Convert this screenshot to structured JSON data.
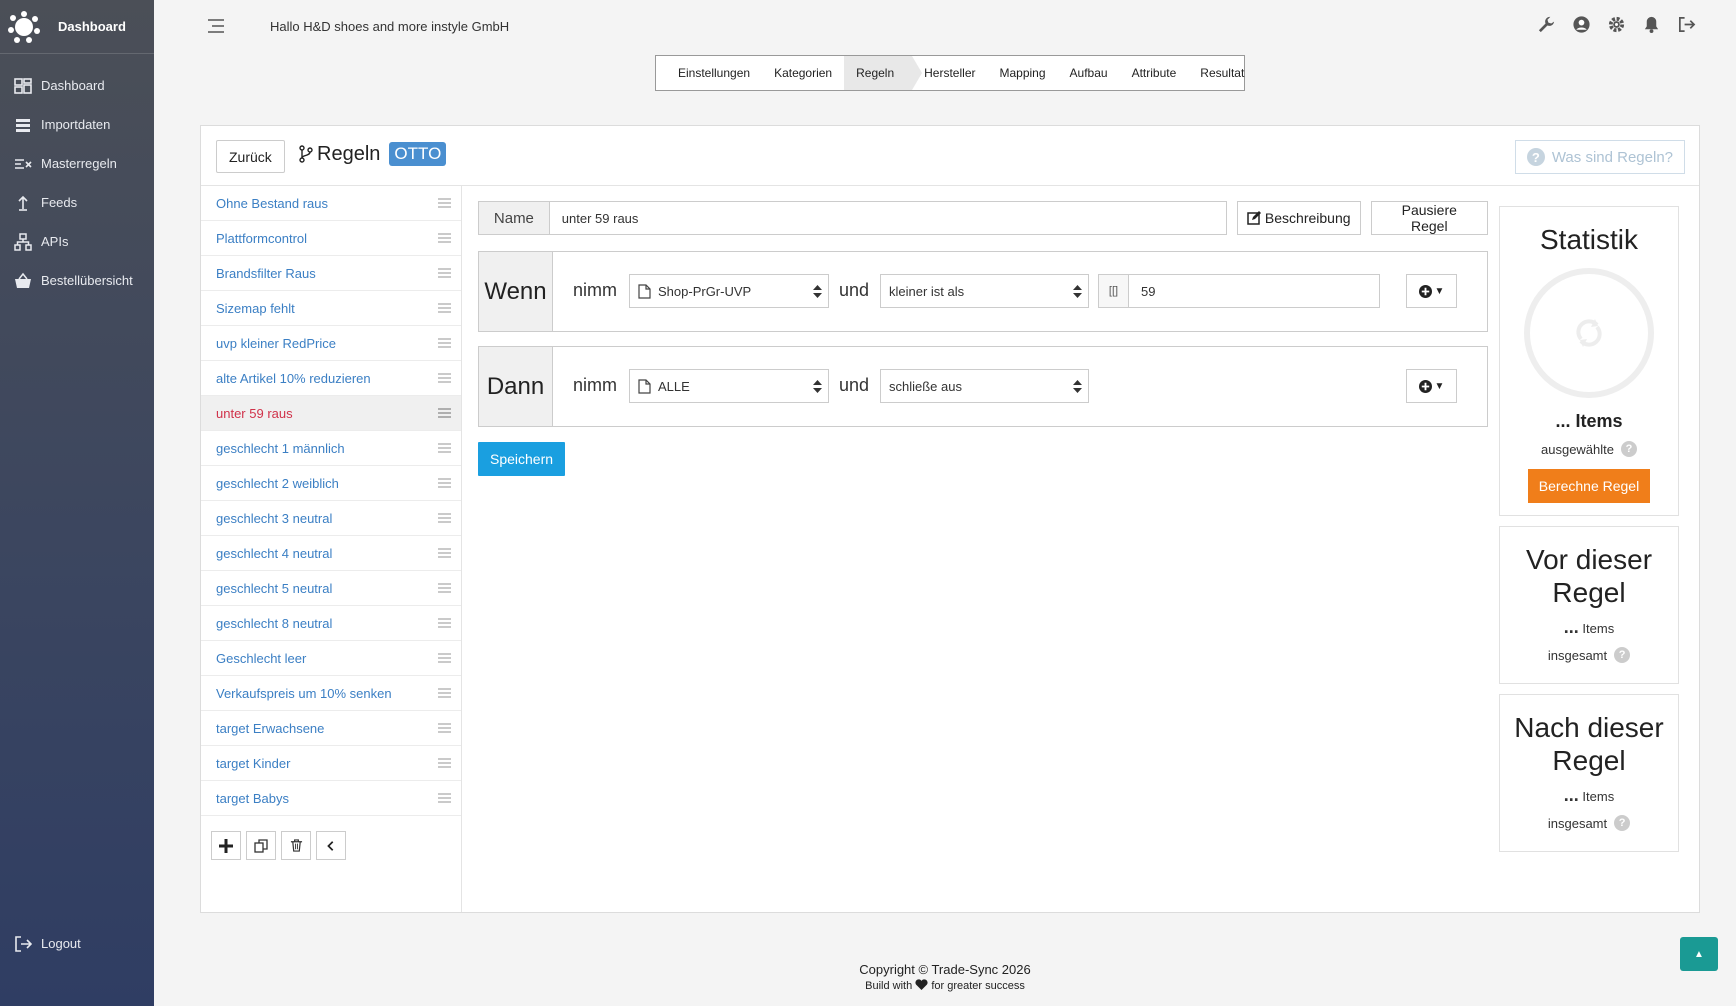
{
  "sidebar": {
    "brand": "Dashboard",
    "items": [
      {
        "label": "Dashboard",
        "icon": "dashboard-icon"
      },
      {
        "label": "Importdaten",
        "icon": "database-icon"
      },
      {
        "label": "Masterregeln",
        "icon": "rules-icon"
      },
      {
        "label": "Feeds",
        "icon": "upload-icon"
      },
      {
        "label": "APIs",
        "icon": "network-icon"
      },
      {
        "label": "Bestellübersicht",
        "icon": "basket-icon"
      }
    ],
    "logout": "Logout"
  },
  "topbar": {
    "greeting": "Hallo H&D shoes and more instyle GmbH",
    "icons": [
      "wrench-icon",
      "user-icon",
      "gear-icon",
      "bell-icon",
      "signout-icon"
    ]
  },
  "steps": [
    "Einstellungen",
    "Kategorien",
    "Regeln",
    "Hersteller",
    "Mapping",
    "Aufbau",
    "Attribute",
    "Resultat"
  ],
  "header": {
    "back": "Zurück",
    "title": "Regeln",
    "badge": "OTTO",
    "help": "Was sind Regeln?"
  },
  "rules": [
    "Ohne Bestand raus",
    "Plattformcontrol",
    "Brandsfilter Raus",
    "Sizemap fehlt",
    "uvp kleiner RedPrice",
    "alte Artikel 10% reduzieren",
    "unter 59 raus",
    "geschlecht 1 männlich",
    "geschlecht 2 weiblich",
    "geschlecht 3 neutral",
    "geschlecht 4 neutral",
    "geschlecht 5 neutral",
    "geschlecht 8 neutral",
    "Geschlecht leer",
    "Verkaufspreis um 10% senken",
    "target Erwachsene",
    "target Kinder",
    "target Babys"
  ],
  "editor": {
    "name_label": "Name",
    "name_value": "unter 59 raus",
    "desc_button": "Beschreibung",
    "pause_button": "Pausiere Regel",
    "wenn": {
      "label": "Wenn",
      "take": "nimm",
      "field": "Shop-PrGr-UVP",
      "and": "und",
      "operator": "kleiner ist als",
      "value_prefix": "[[]",
      "value": "59"
    },
    "dann": {
      "label": "Dann",
      "take": "nimm",
      "field": "ALLE",
      "and": "und",
      "action": "schließe aus"
    },
    "save": "Speichern"
  },
  "stats": {
    "title": "Statistik",
    "items": "... Items",
    "selected": "ausgewählte",
    "calc": "Berechne Regel",
    "before_title": "Vor dieser Regel",
    "after_title": "Nach dieser Regel",
    "dots": "...",
    "items_word": "Items",
    "total": "insgesamt",
    "q": "?"
  },
  "footer": {
    "copyright": "Copyright © Trade-Sync 2026",
    "build_pre": "Build with",
    "build_post": "for greater success"
  },
  "colors": {
    "accent": "#1a9fe0",
    "orange": "#f07e1a",
    "badge": "#4a8fd0",
    "active_rule": "#d0324a",
    "link": "#3b7fc4"
  }
}
